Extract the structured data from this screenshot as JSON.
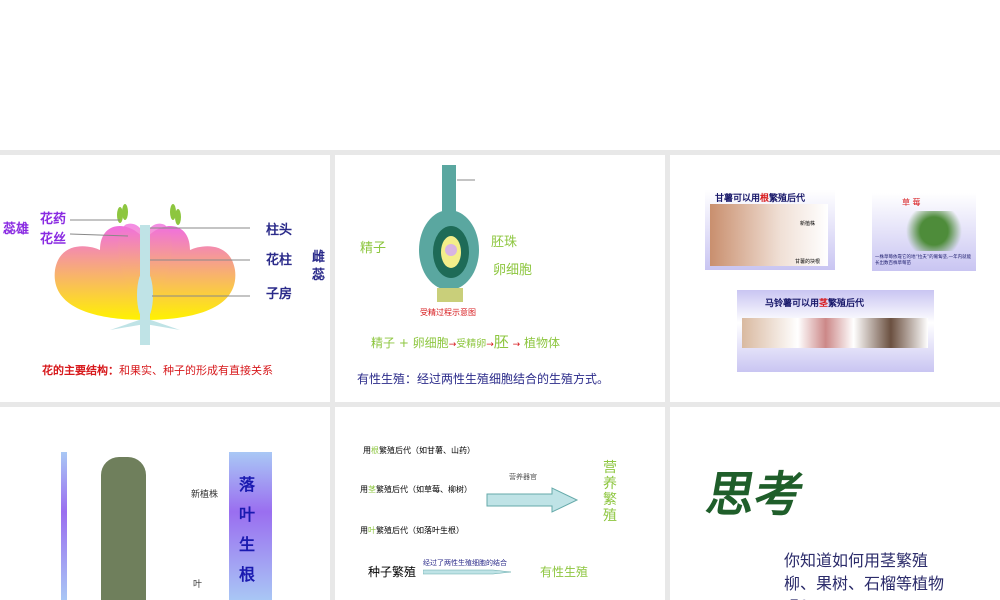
{
  "slides": [
    {
      "stamen": "蕊雄",
      "anther": "花药",
      "filament": "花丝",
      "stigma": "柱头",
      "style": "花柱",
      "ovary": "子房",
      "pistil": "雌蕊",
      "caption_bold": "花的主要结构：",
      "caption": "和果实、种子的形成有直接关系"
    },
    {
      "sperm": "精子",
      "ovule": "胚珠",
      "egg": "卵细胞",
      "diagram_title": "受精过程示意图",
      "flow": [
        "精子 + 卵细胞",
        "→",
        "受精卵",
        "→",
        "胚",
        "→",
        "植物体"
      ],
      "definition": "有性生殖：经过两性生殖细胞结合的生殖方式。"
    },
    {
      "sweet_potato_title_a": "甘薯可以用",
      "sweet_potato_root": "根",
      "sweet_potato_title_b": "繁殖后代",
      "new_plant": "新植株",
      "tuber_root": "甘薯的块根",
      "strawberry_title": "草 莓",
      "strawberry_caption": "一株草莓依靠它的地“拉夫”的匍匐茎,一年内就能长出数百株草莓苗",
      "potato_title_a": "马铃薯可以用",
      "potato_stem": "茎",
      "potato_title_b": "繁殖后代"
    },
    {
      "new_plant": "新植株",
      "leaf": "叶",
      "title": [
        "落",
        "叶",
        "生",
        "根"
      ]
    },
    {
      "rows": [
        {
          "pre": "用",
          "key": "根",
          "post": "繁殖后代（如甘薯、山药）"
        },
        {
          "pre": "用",
          "key": "茎",
          "post": "繁殖后代（如草莓、柳树）"
        },
        {
          "pre": "用",
          "key": "叶",
          "post": "繁殖后代（如落叶生根）"
        }
      ],
      "arrow_label": "营养器官",
      "vegetative": "营养繁殖",
      "seed": "种子繁殖",
      "seed_arrow_label": "经过了两性生殖细胞的结合",
      "sexual": "有性生殖"
    },
    {
      "think": "思考",
      "question": "你知道如何用茎繁殖柳、果树、石榴等植物吗？"
    }
  ],
  "colors": {
    "purple": "#8a2be2",
    "navy": "#2b2b8a",
    "green": "#8dc63f",
    "red": "#d7191c"
  }
}
